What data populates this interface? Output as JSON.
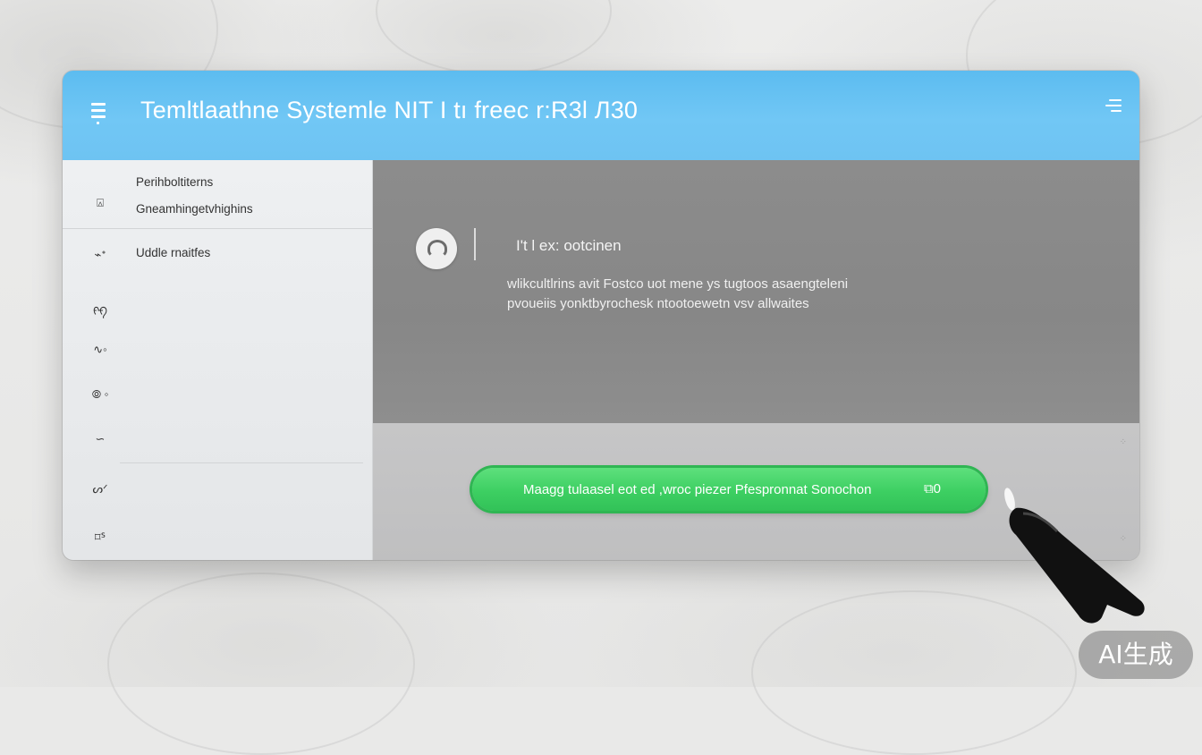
{
  "window": {
    "title": "Temltlaathne Systemle NIT I tı freec r:R3l Л30"
  },
  "icons": {
    "menu": "menu-icon",
    "header_action": "list-action-icon",
    "avatar": "chat-icon",
    "button": "device-icon",
    "cursor": "mouse-pointer-icon"
  },
  "sidebar": {
    "items": [
      {
        "icon": "⍓",
        "label": "Perihboltiterns"
      },
      {
        "icon": "",
        "label": "Gneamhingetvhighins"
      },
      {
        "icon": "⌁ᐩ",
        "label": "Uddle rnaitfes"
      },
      {
        "icon": "ᠻᠻ",
        "label": ""
      },
      {
        "icon": "∿◦",
        "label": ""
      },
      {
        "icon": "⦾ ◦",
        "label": ""
      },
      {
        "icon": "∽",
        "label": ""
      },
      {
        "icon": "ᔕᐟ",
        "label": ""
      },
      {
        "icon": "⌑ᔆ",
        "label": ""
      }
    ]
  },
  "message": {
    "title": "I't l ex: ootcinen",
    "body_line1": "wlikcultlrins avit Fostco uot mene ys tugtoos asaengteleni",
    "body_line2": "pvoueiis yonktbyrochesk ntootoewetn vsv allwaites"
  },
  "action_button": {
    "label": "Maagg tulaasel eot ed ,wroc piezer Pfespronnat Sonochon",
    "icon_text": "⧉0"
  },
  "watermark": {
    "text": "AI生成"
  },
  "colors": {
    "header": "#6ec3f2",
    "button": "#3dcf62",
    "content": "#8a8a8a",
    "sidebar": "#e9ebed"
  }
}
